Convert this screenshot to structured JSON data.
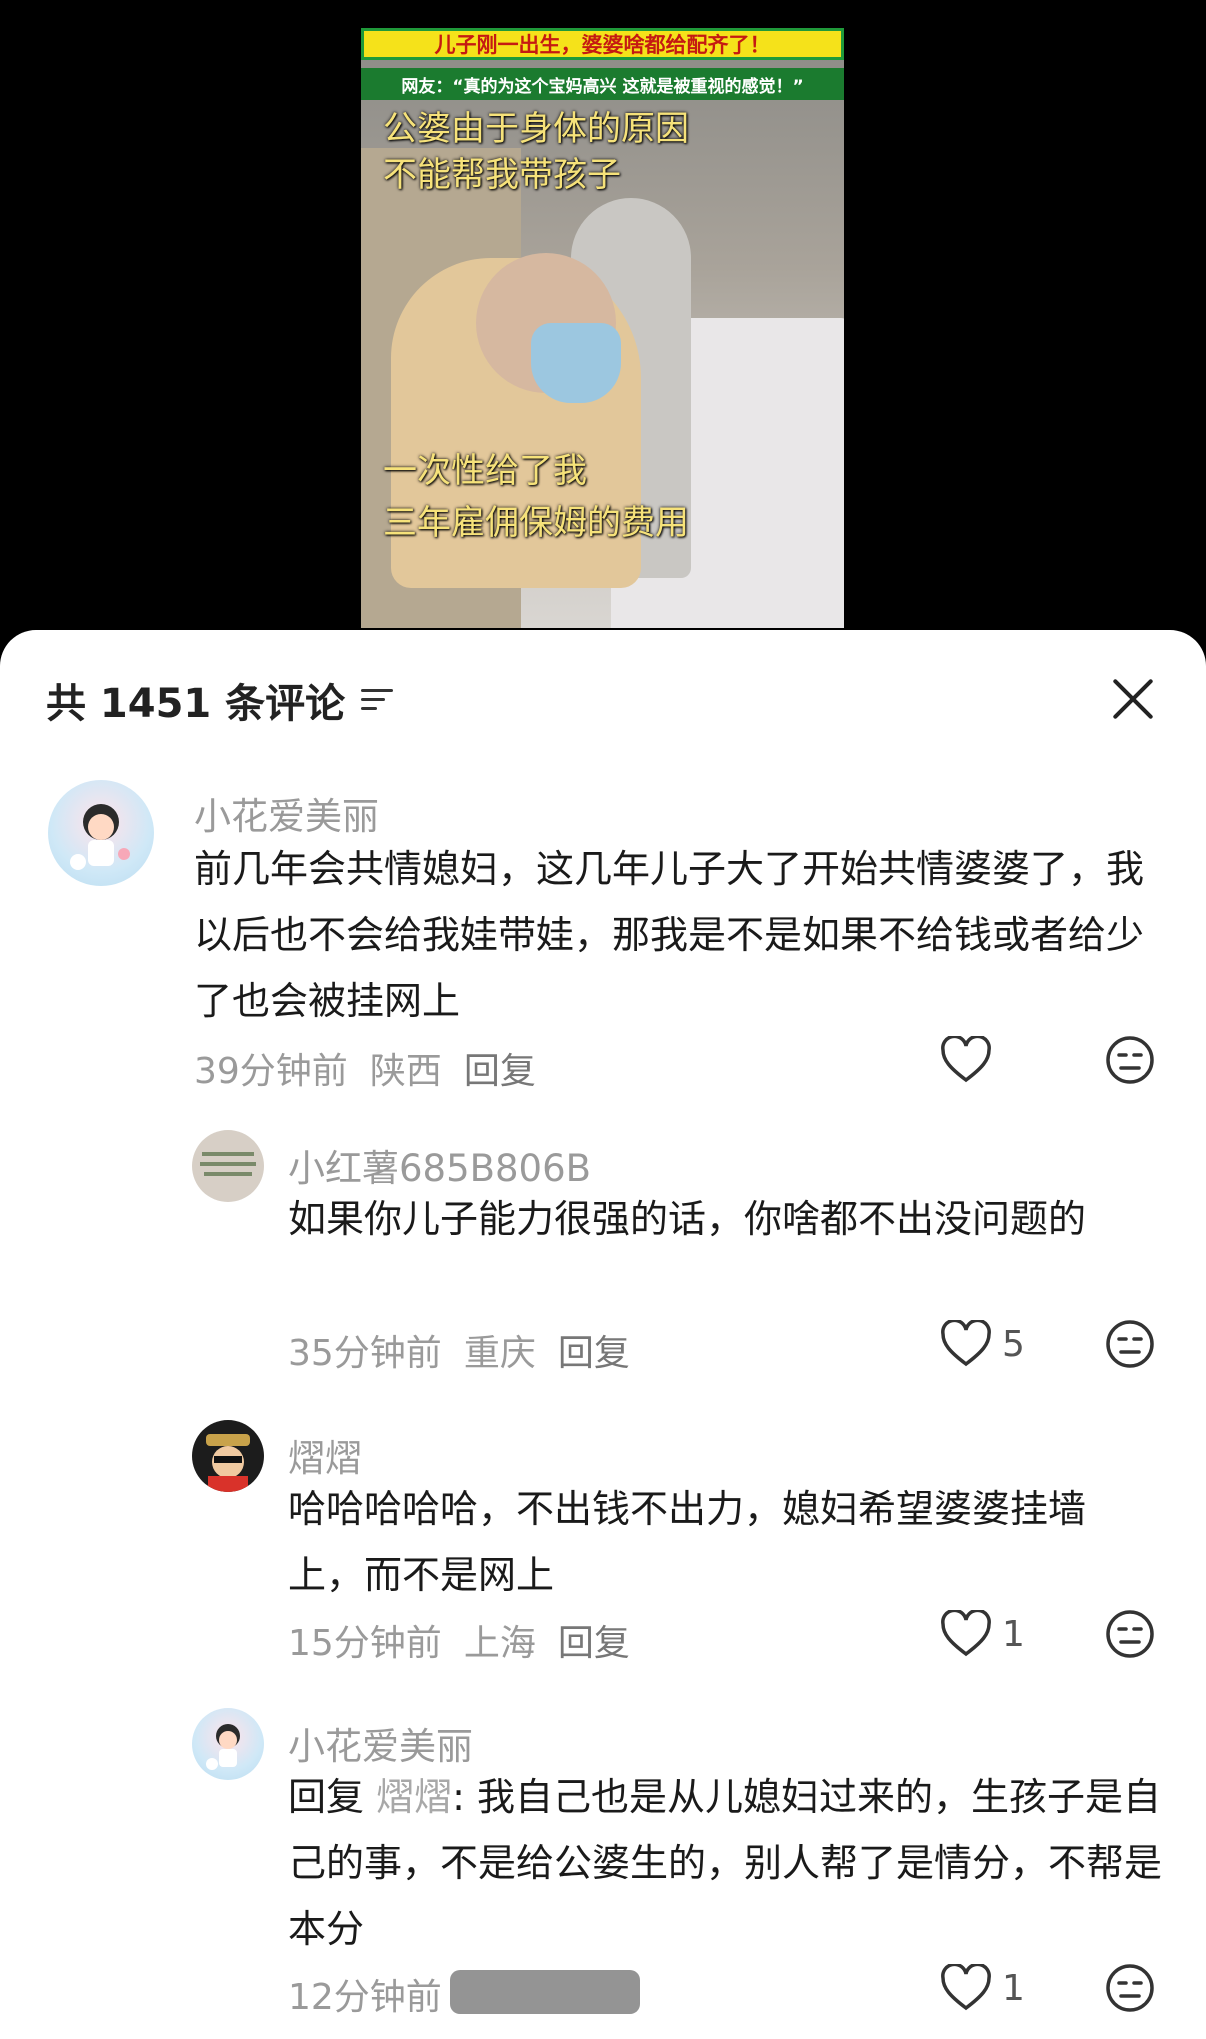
{
  "video": {
    "title": "儿子刚一出生，婆婆啥都给配齐了！",
    "subtitle": "网友：“真的为这个宝妈高兴 这就是被重视的感觉！”",
    "caption_top_1": "公婆由于身体的原因",
    "caption_top_2": "不能帮我带孩子",
    "caption_bottom_1": "一次性给了我",
    "caption_bottom_2": "三年雇佣保姆的费用"
  },
  "sheet": {
    "header": "共 1451 条评论"
  },
  "comments": [
    {
      "name": "小花爱美丽",
      "text": "前几年会共情媳妇，这几年儿子大了开始共情婆婆了，我以后也不会给我娃带娃，那我是不是如果不给钱或者给少了也会被挂网上",
      "time": "39分钟前",
      "location": "陕西",
      "reply": "回复",
      "likes": ""
    },
    {
      "name": "小红薯685B806B",
      "text": "如果你儿子能力很强的话，你啥都不出没问题的",
      "time": "35分钟前",
      "location": "重庆",
      "reply": "回复",
      "likes": "5"
    },
    {
      "name": "熠熠",
      "text": "哈哈哈哈哈，不出钱不出力，媳妇希望婆婆挂墙上，而不是网上",
      "time": "15分钟前",
      "location": "上海",
      "reply": "回复",
      "likes": "1"
    },
    {
      "name": "小花爱美丽",
      "reply_prefix": "回复",
      "mention": "熠熠",
      "text": ": 我自己也是从儿媳妇过来的，生孩子是自己的事，不是给公婆生的，别人帮了是情分，不帮是本分",
      "time": "12分钟前",
      "likes": "1"
    }
  ]
}
